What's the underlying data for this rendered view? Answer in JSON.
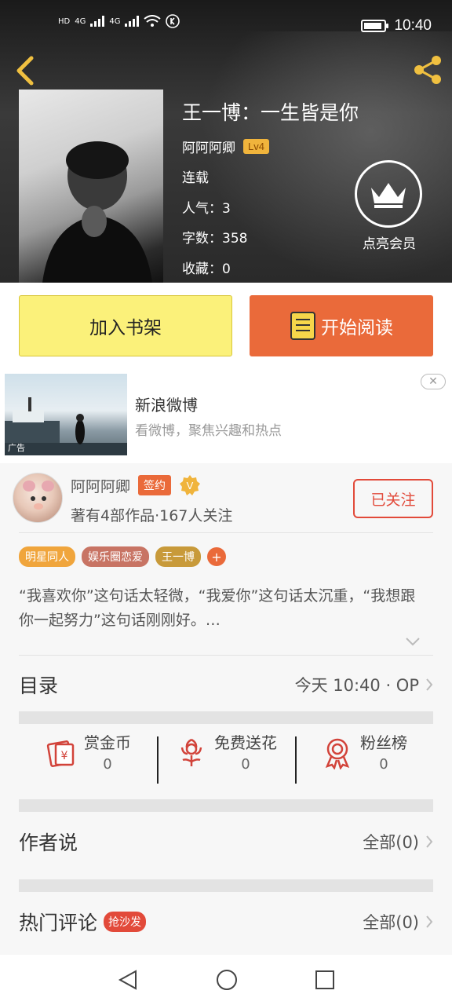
{
  "status_bar": {
    "left_labels": [
      "HD",
      "4G",
      "4G"
    ],
    "time": "10:40",
    "battery_level": 0.9
  },
  "book": {
    "title": "王一博：一生皆是你",
    "author": "阿阿阿卿",
    "level": "Lv4",
    "status": "连载",
    "popularity": "人气：3",
    "word_count": "字数：358",
    "favorites": "收藏：0"
  },
  "vip": {
    "label": "点亮会员"
  },
  "actions": {
    "add_shelf": "加入书架",
    "start_reading": "开始阅读"
  },
  "ad": {
    "title": "新浪微博",
    "subtitle": "看微博，聚焦兴趣和热点",
    "tag": "广告",
    "close": "✕"
  },
  "author_card": {
    "name": "阿阿阿卿",
    "sign_badge": "签约",
    "verified": "V",
    "works": "著有4部作品·167人关注",
    "follow_label": "已关注"
  },
  "tags": [
    {
      "label": "明星同人",
      "color": "#f0a53c"
    },
    {
      "label": "娱乐圈恋爱",
      "color": "#c87464"
    },
    {
      "label": "王一博",
      "color": "#c89a3a"
    }
  ],
  "tag_add": "+",
  "description": "“我喜欢你”这句话太轻微，“我爱你”这句话太沉重，“我想跟你一起努力”这句话刚刚好。…",
  "catalog": {
    "title": "目录",
    "update": "今天 10:40 · OP"
  },
  "stats": [
    {
      "label": "赏金币",
      "value": "0",
      "icon": "coin-envelope-icon"
    },
    {
      "label": "免费送花",
      "value": "0",
      "icon": "flower-icon"
    },
    {
      "label": "粉丝榜",
      "value": "0",
      "icon": "medal-icon"
    }
  ],
  "author_says": {
    "title": "作者说",
    "count": "全部(0)"
  },
  "hot_comments": {
    "title": "热门评论",
    "badge": "抢沙发",
    "count": "全部(0)"
  },
  "colors": {
    "accent_orange": "#ea6a3a",
    "shelf_yellow": "#fbf17a",
    "follow_red": "#e24a3a",
    "level_gold": "#f0b43c"
  }
}
